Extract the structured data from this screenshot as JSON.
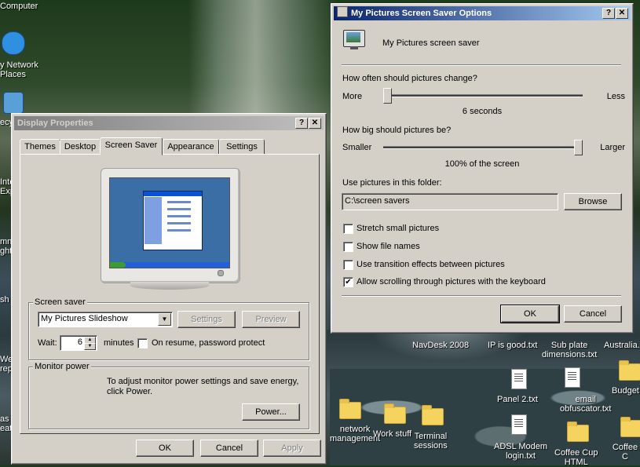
{
  "desktop": {
    "icons": [
      {
        "label": "Computer"
      },
      {
        "label": "y Network\nPlaces"
      },
      {
        "label": "ecy"
      },
      {
        "label": "Inte\nExp"
      },
      {
        "label": "mn\nght"
      },
      {
        "label": "sh"
      },
      {
        "label": "We\nrep"
      },
      {
        "label": "as\neat"
      },
      {
        "label": "NavDesk 2008"
      },
      {
        "label": "IP is good.txt"
      },
      {
        "label": "Sub plate\ndimensions.txt"
      },
      {
        "label": "Australia."
      },
      {
        "label": "Panel 2.txt"
      },
      {
        "label": "email\nobfuscator.txt"
      },
      {
        "label": "Budget"
      },
      {
        "label": "network\nmanagement"
      },
      {
        "label": "Work stuff"
      },
      {
        "label": "Terminal\nsessions"
      },
      {
        "label": "ADSL Modem\nlogin.txt"
      },
      {
        "label": "Coffee Cup\nHTML"
      },
      {
        "label": "Coffee C"
      }
    ]
  },
  "display_props": {
    "title": "Display Properties",
    "help_btn": "?",
    "close_btn": "✕",
    "tabs": [
      "Themes",
      "Desktop",
      "Screen Saver",
      "Appearance",
      "Settings"
    ],
    "screensaver_group": "Screen saver",
    "screensaver_value": "My Pictures Slideshow",
    "settings_btn": "Settings",
    "preview_btn": "Preview",
    "wait_label": "Wait:",
    "wait_value": "6",
    "minutes_label": "minutes",
    "password_label": "On resume, password protect",
    "monitor_group": "Monitor power",
    "monitor_text": "To adjust monitor power settings and save energy, click Power.",
    "power_btn": "Power...",
    "ok_btn": "OK",
    "cancel_btn": "Cancel",
    "apply_btn": "Apply"
  },
  "options": {
    "title": "My Pictures Screen Saver Options",
    "help_btn": "?",
    "close_btn": "✕",
    "header": "My Pictures screen saver",
    "change_question": "How often should pictures change?",
    "more_label": "More",
    "less_label": "Less",
    "change_value": "6 seconds",
    "change_fraction": 0.0,
    "size_question": "How big should pictures be?",
    "smaller_label": "Smaller",
    "larger_label": "Larger",
    "size_value": "100% of the screen",
    "size_fraction": 1.0,
    "folder_label": "Use pictures in this folder:",
    "folder_value": "C:\\screen savers",
    "browse_btn": "Browse",
    "checks": [
      {
        "label": "Stretch small pictures",
        "checked": false
      },
      {
        "label": "Show file names",
        "checked": false
      },
      {
        "label": "Use transition effects between pictures",
        "checked": false
      },
      {
        "label": "Allow scrolling through pictures with the keyboard",
        "checked": true
      }
    ],
    "ok_btn": "OK",
    "cancel_btn": "Cancel"
  }
}
